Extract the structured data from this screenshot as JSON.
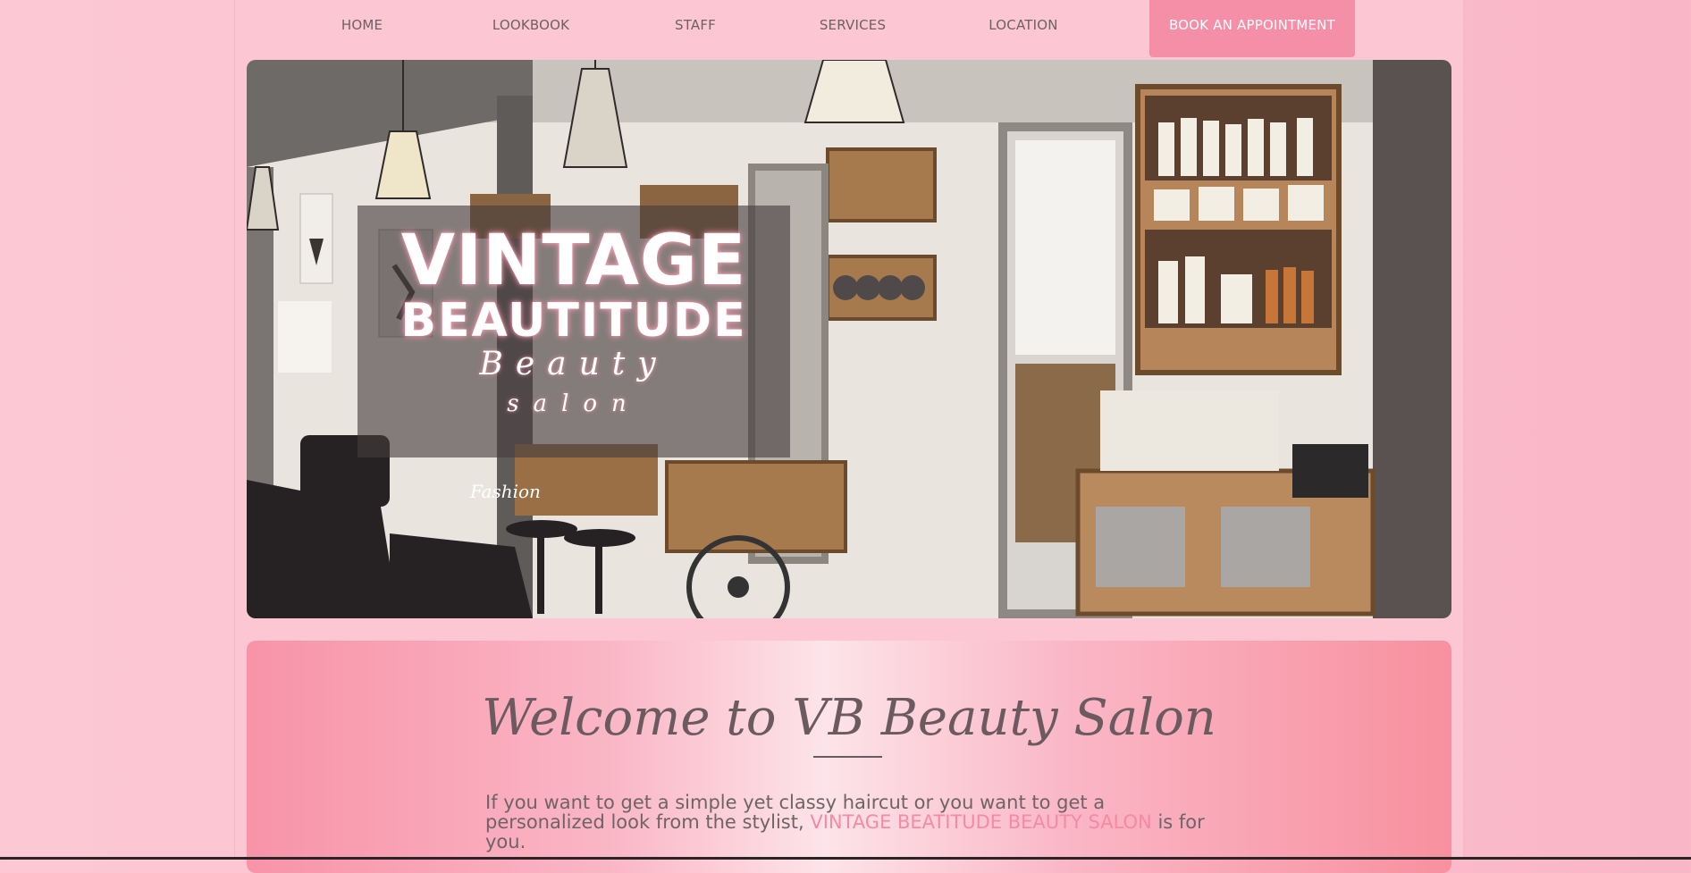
{
  "nav": {
    "items": [
      {
        "label": "HOME"
      },
      {
        "label": "LOOKBOOK"
      },
      {
        "label": "STAFF"
      },
      {
        "label": "SERVICES"
      },
      {
        "label": "LOCATION"
      }
    ],
    "cta_label": "BOOK AN APPOINTMENT"
  },
  "hero": {
    "title_line1": "VINTAGE",
    "title_line2": "BEAUTITUDE",
    "subtitle_line1": "Beauty",
    "subtitle_line2": "salon",
    "decor_text": "Fashion"
  },
  "welcome": {
    "title": "Welcome to VB Beauty Salon",
    "body_before": "If you want to get a simple yet classy haircut or you want to get a personalized look from the stylist, ",
    "body_highlight": "VINTAGE BEATITUDE BEAUTY SALON",
    "body_after": " is for you."
  },
  "colors": {
    "page_background": "#fcc7d3",
    "accent_pink": "#f58ea7",
    "highlight_text": "#f68aa2",
    "heading_text": "#6b5a5f"
  }
}
